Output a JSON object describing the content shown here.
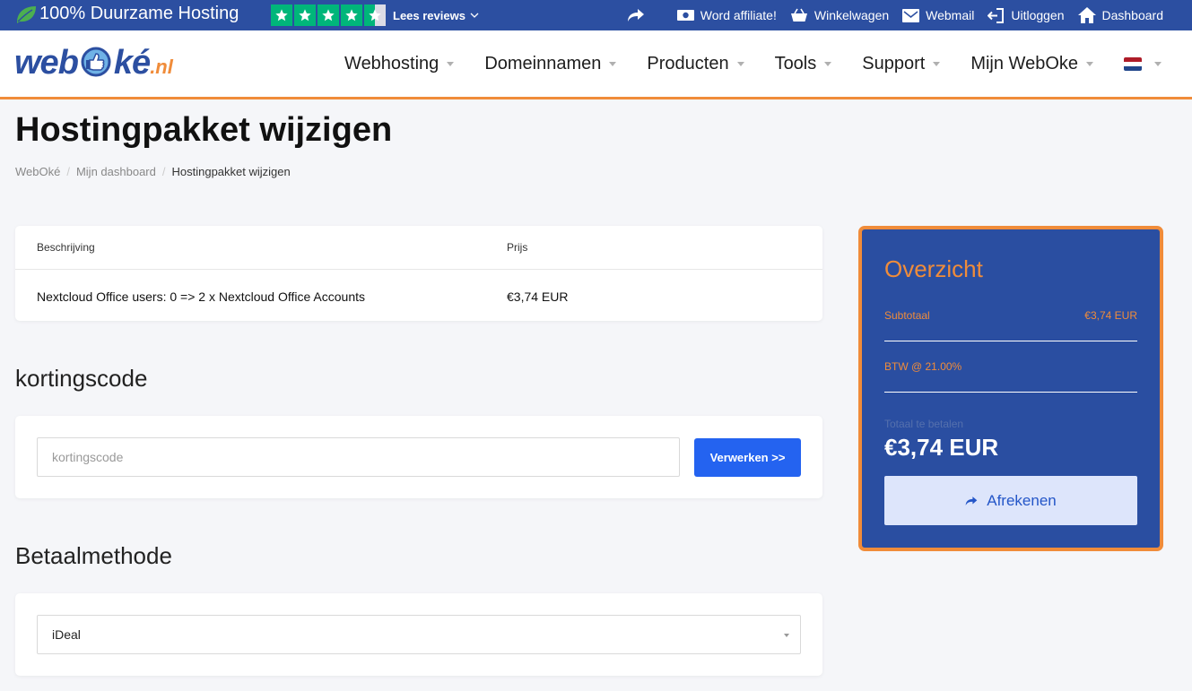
{
  "topbar": {
    "eco_text": "100% Duurzame Hosting",
    "trustpilot_rating": 4.5,
    "reviews_label": "Lees reviews",
    "links": {
      "affiliate": "Word affiliate!",
      "cart": "Winkelwagen",
      "webmail": "Webmail",
      "logout": "Uitloggen",
      "dashboard": "Dashboard"
    }
  },
  "logo": {
    "part1": "web",
    "part2": "ké",
    "part3": ".nl"
  },
  "nav": {
    "webhosting": "Webhosting",
    "domains": "Domeinnamen",
    "products": "Producten",
    "tools": "Tools",
    "support": "Support",
    "account": "Mijn WebOke"
  },
  "page": {
    "title": "Hostingpakket wijzigen",
    "breadcrumb": [
      "WebOké",
      "Mijn dashboard",
      "Hostingpakket wijzigen"
    ]
  },
  "table": {
    "headers": {
      "description": "Beschrijving",
      "price": "Prijs"
    },
    "rows": [
      {
        "description": "Nextcloud Office users: 0 => 2 x Nextcloud Office Accounts",
        "price": "€3,74 EUR"
      }
    ]
  },
  "coupon": {
    "heading": "kortingscode",
    "placeholder": "kortingscode",
    "button": "Verwerken >>"
  },
  "payment": {
    "heading": "Betaalmethode",
    "selected": "iDeal"
  },
  "summary": {
    "heading": "Overzicht",
    "subtotal_label": "Subtotaal",
    "subtotal_value": "€3,74 EUR",
    "vat_label": "BTW @ 21.00%",
    "total_label": "Totaal te betalen",
    "total_value": "€3,74 EUR",
    "checkout_label": "Afrekenen"
  },
  "colors": {
    "brand_blue": "#2c4fa1",
    "accent_orange": "#f08c3a",
    "button_blue": "#2463f0",
    "trustpilot_green": "#00b67a"
  }
}
